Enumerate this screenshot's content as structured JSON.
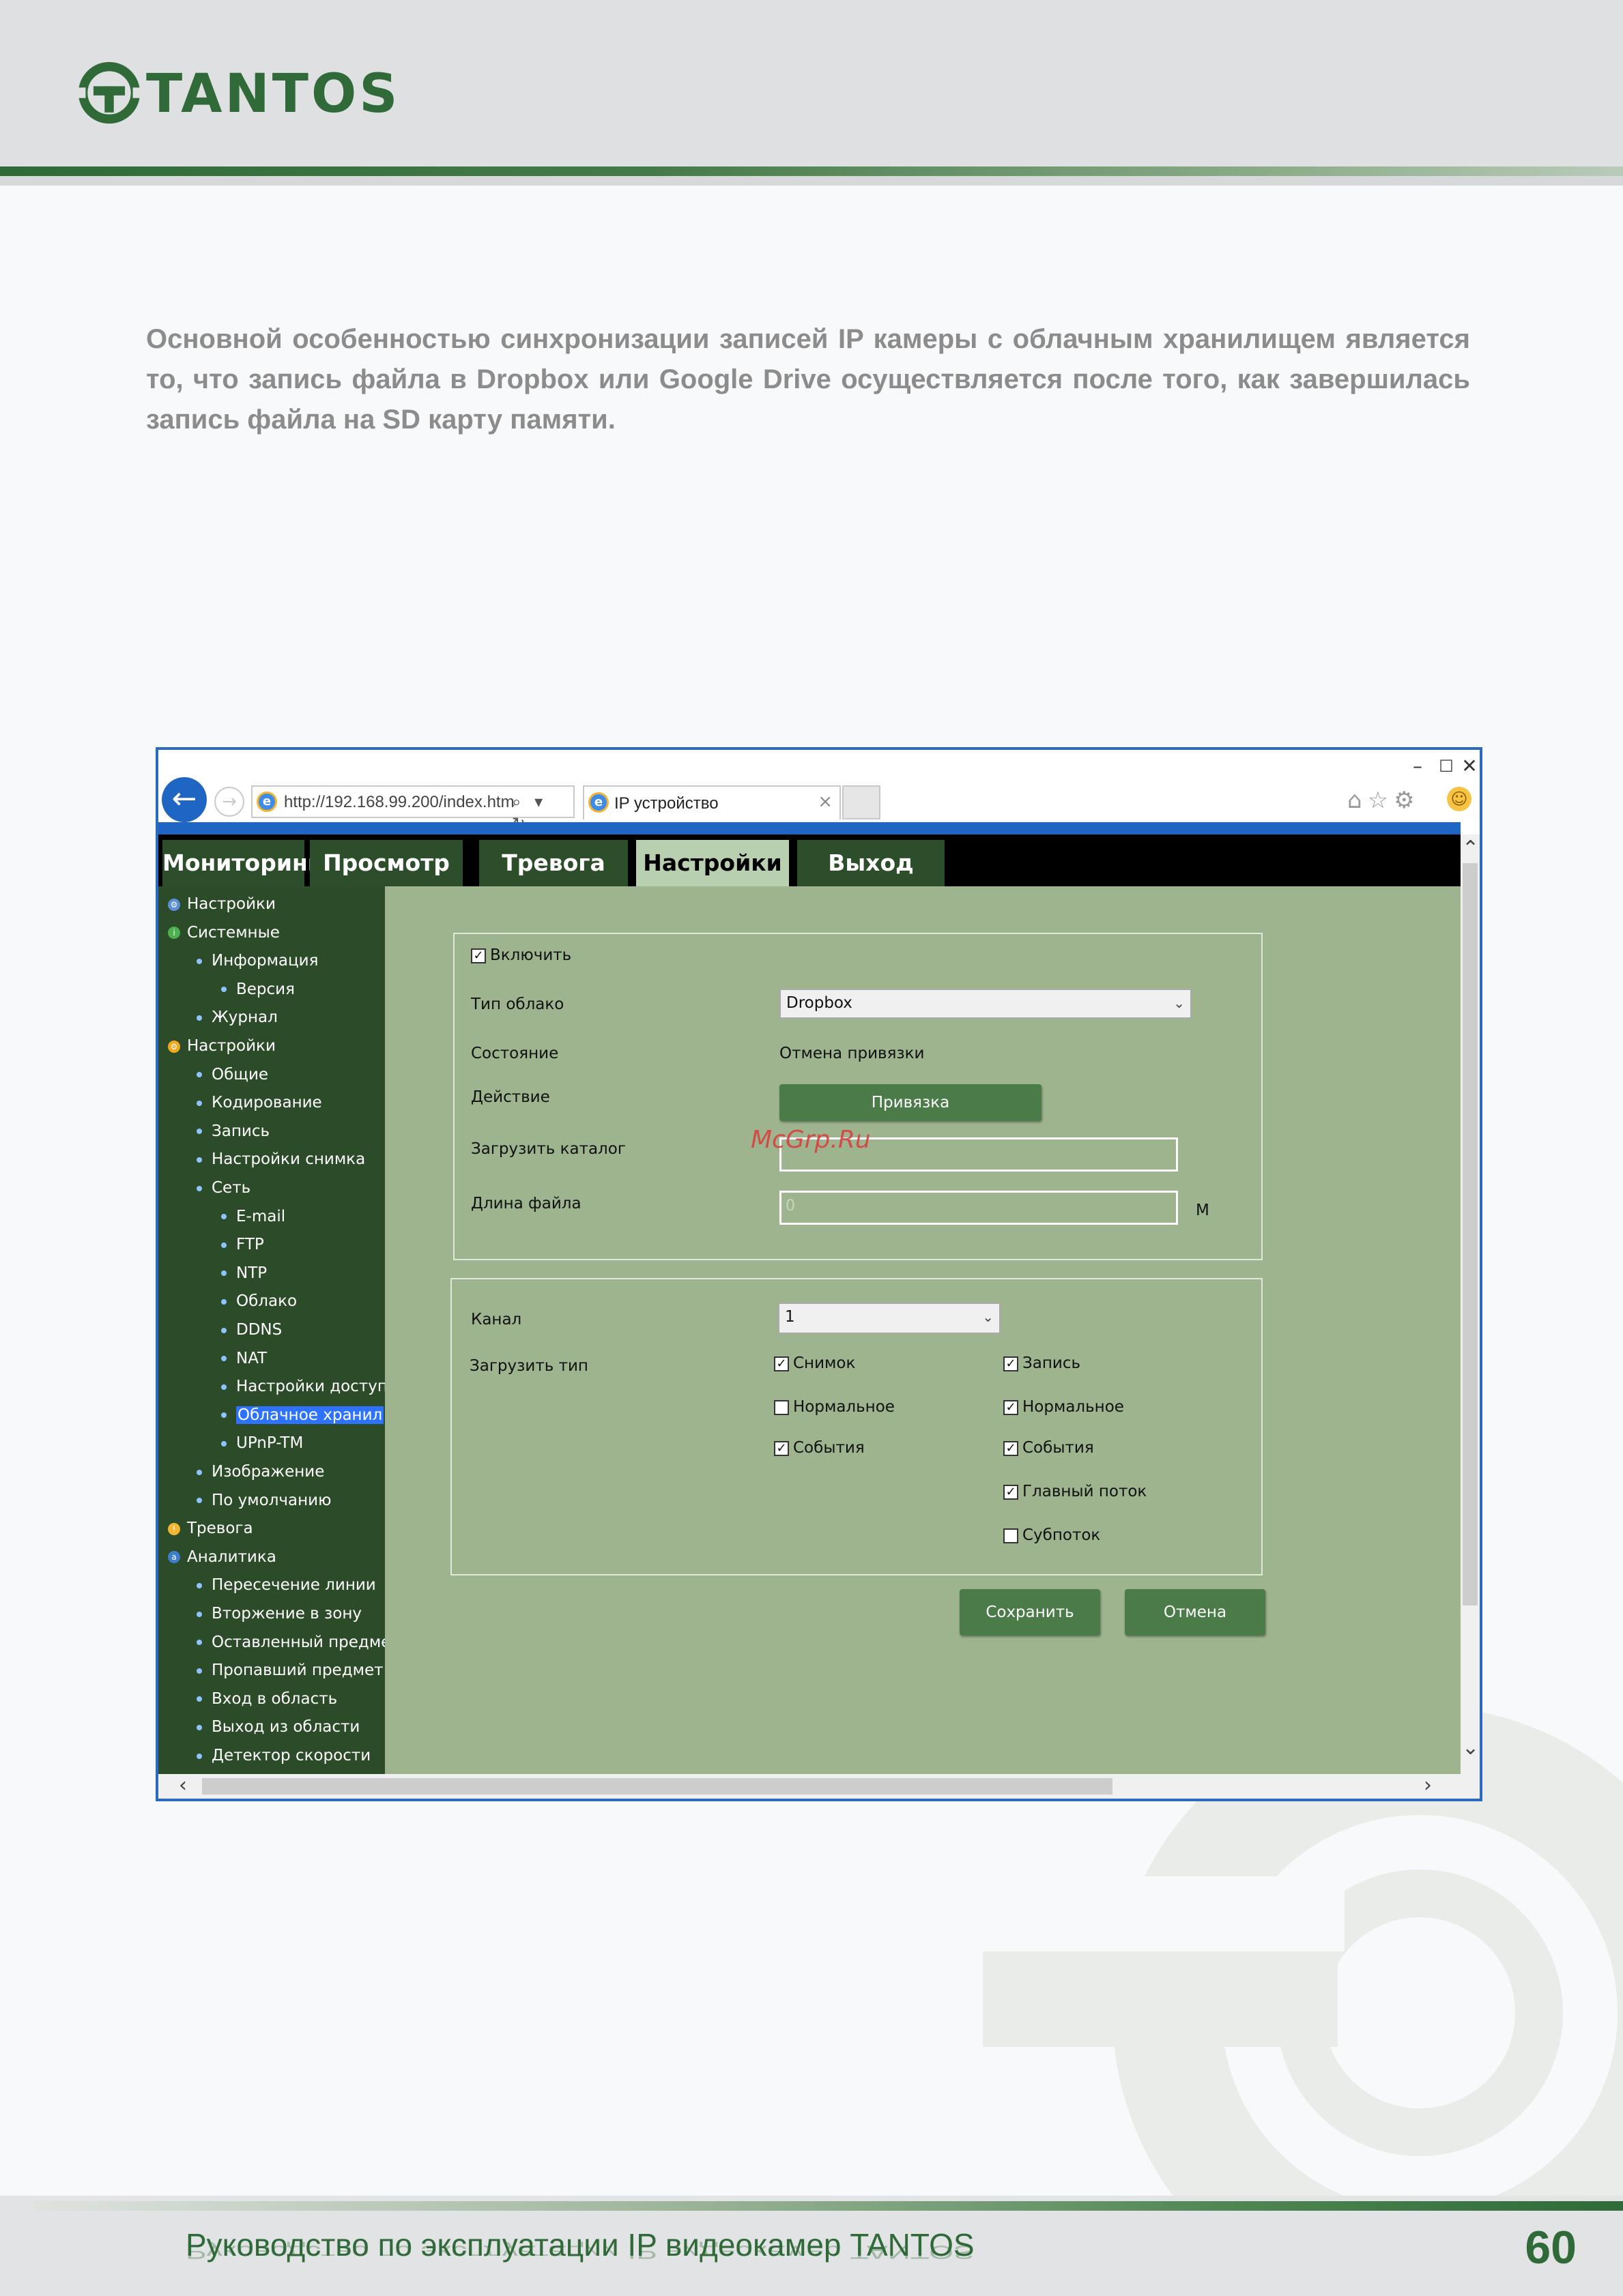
{
  "header": {
    "brand": "TANTOS"
  },
  "intro_text": "Основной особенностью синхронизации записей IP камеры с облачным хранилищем является то, что запись файла в Dropbox или Google Drive осуществляется после того, как завершилась запись файла на SD карту памяти.",
  "screenshot": {
    "window_buttons": {
      "minimize": "–",
      "maximize": "☐",
      "close": "✕"
    },
    "url": "http://192.168.99.200/index.htm",
    "url_icons": "⌕ ▾ ↻",
    "tab_title": "IP устройство",
    "tab_close": "×",
    "menu_tabs": [
      "Мониторинг",
      "Просмотр",
      "Тревога",
      "Настройки",
      "Выход"
    ],
    "active_tab": "Настройки",
    "tree": [
      {
        "label": "Настройки",
        "level": 0,
        "icon": "settings-icon"
      },
      {
        "label": "Системные",
        "level": 0,
        "icon": "info-icon"
      },
      {
        "label": "Информация",
        "level": 1
      },
      {
        "label": "Версия",
        "level": 2
      },
      {
        "label": "Журнал",
        "level": 1
      },
      {
        "label": "Настройки",
        "level": 0,
        "icon": "gear-icon"
      },
      {
        "label": "Общие",
        "level": 1
      },
      {
        "label": "Кодирование",
        "level": 1
      },
      {
        "label": "Запись",
        "level": 1
      },
      {
        "label": "Настройки снимка",
        "level": 1
      },
      {
        "label": "Сеть",
        "level": 1
      },
      {
        "label": "E-mail",
        "level": 2
      },
      {
        "label": "FTP",
        "level": 2
      },
      {
        "label": "NTP",
        "level": 2
      },
      {
        "label": "Облако",
        "level": 2
      },
      {
        "label": "DDNS",
        "level": 2
      },
      {
        "label": "NAT",
        "level": 2
      },
      {
        "label": "Настройки доступ",
        "level": 2
      },
      {
        "label": "Облачное хранил",
        "level": 2,
        "selected": true
      },
      {
        "label": "UPnP-TM",
        "level": 2
      },
      {
        "label": "Изображение",
        "level": 1
      },
      {
        "label": "По умолчанию",
        "level": 1
      },
      {
        "label": "Тревога",
        "level": 0,
        "icon": "bell-icon"
      },
      {
        "label": "Аналитика",
        "level": 0,
        "icon": "analytics-icon"
      },
      {
        "label": "Пересечение линии",
        "level": 1
      },
      {
        "label": "Вторжение в зону",
        "level": 1
      },
      {
        "label": "Оставленный предме",
        "level": 1
      },
      {
        "label": "Пропавший предмет",
        "level": 1
      },
      {
        "label": "Вход в область",
        "level": 1
      },
      {
        "label": "Выход из области",
        "level": 1
      },
      {
        "label": "Детектор скорости",
        "level": 1
      }
    ],
    "cloud_form": {
      "enable_label": "Включить",
      "enable_checked": true,
      "cloud_type_label": "Тип облако",
      "cloud_type_value": "Dropbox",
      "state_label": "Состояние",
      "state_value": "Отмена привязки",
      "action_label": "Действие",
      "bind_button": "Привязка",
      "upload_dir_label": "Загрузить каталог",
      "upload_dir_value": "",
      "file_length_label": "Длина файла",
      "file_length_value": "0",
      "file_length_unit": "M"
    },
    "upload_form": {
      "channel_label": "Канал",
      "channel_value": "1",
      "upload_type_label": "Загрузить тип",
      "snapshot": {
        "label": "Снимок",
        "checked": true
      },
      "snapshot_normal": {
        "label": "Нормальное",
        "checked": false
      },
      "snapshot_events": {
        "label": "События",
        "checked": true
      },
      "record": {
        "label": "Запись",
        "checked": true
      },
      "record_normal": {
        "label": "Нормальное",
        "checked": true
      },
      "record_events": {
        "label": "События",
        "checked": true
      },
      "main_stream": {
        "label": "Главный поток",
        "checked": true
      },
      "sub_stream": {
        "label": "Субпоток",
        "checked": false
      }
    },
    "save_button": "Сохранить",
    "cancel_button": "Отмена",
    "watermark": "McGrp.Ru"
  },
  "footer": {
    "title": "Руководство по эксплуатации IP видеокамер TANTOS",
    "page_number": "60"
  },
  "colors": {
    "brand_green": "#2f6a38",
    "panel_green": "#9db48f",
    "tree_green": "#2c4b29",
    "button_green": "#4a7b48",
    "browser_blue": "#1f66c4",
    "selected_blue": "#2d73ff"
  }
}
